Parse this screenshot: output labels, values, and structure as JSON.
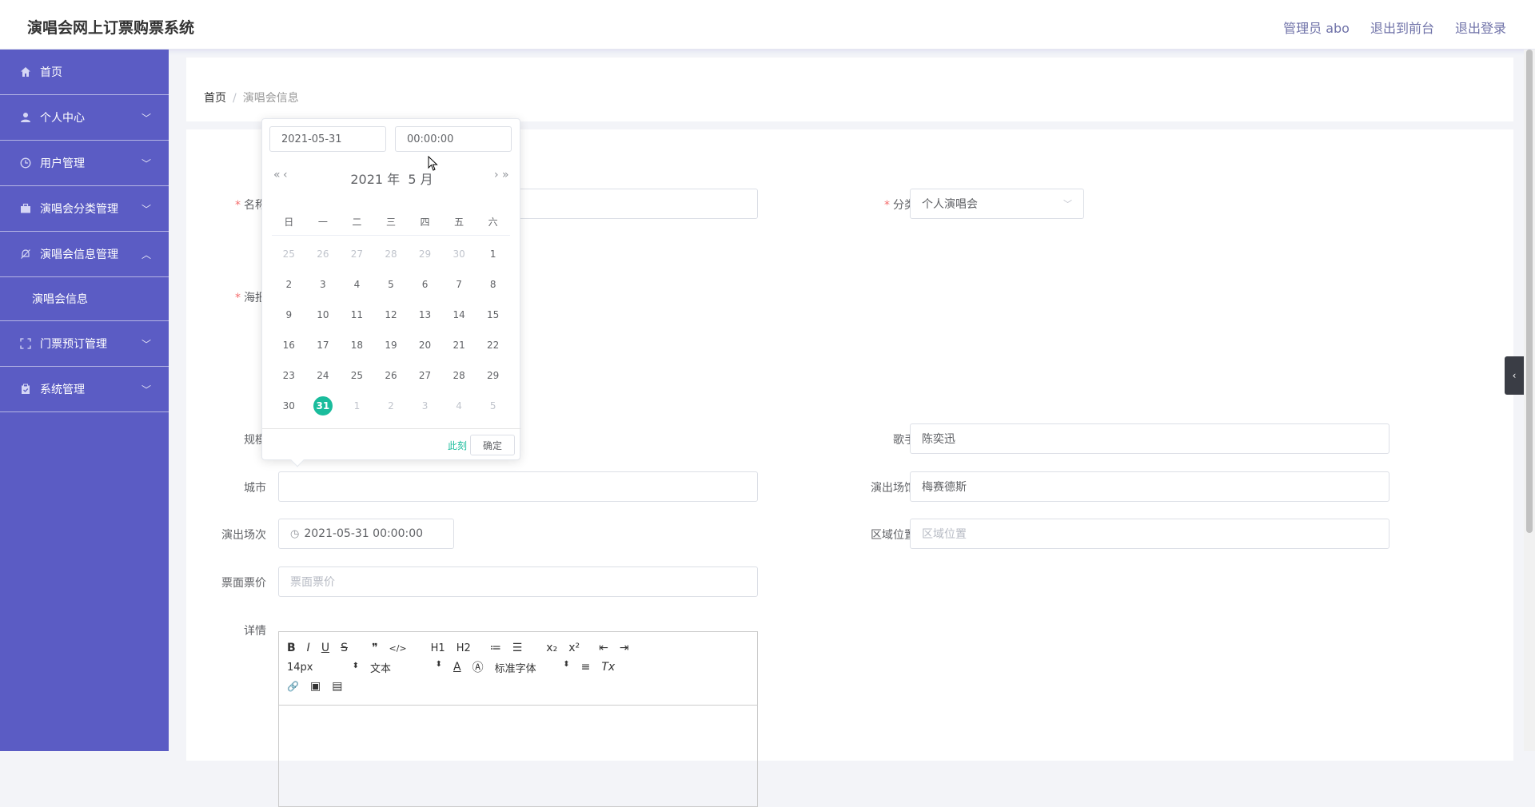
{
  "header": {
    "title": "演唱会网上订票购票系统",
    "links": [
      "管理员 abo",
      "退出到前台",
      "退出登录"
    ]
  },
  "sidebar": {
    "items": [
      {
        "label": "首页",
        "icon": "home-icon"
      },
      {
        "label": "个人中心",
        "icon": "user-icon"
      },
      {
        "label": "用户管理",
        "icon": "clock-icon"
      },
      {
        "label": "演唱会分类管理",
        "icon": "briefcase-icon"
      },
      {
        "label": "演唱会信息管理",
        "icon": "bell-off-icon"
      },
      {
        "label": "门票预订管理",
        "icon": "fullscreen-icon"
      },
      {
        "label": "系统管理",
        "icon": "clipboard-icon"
      }
    ],
    "submenu": "演唱会信息"
  },
  "breadcrumb": {
    "home": "首页",
    "current": "演唱会信息"
  },
  "form": {
    "name_label": "名称",
    "category_label": "分类",
    "category_value": "个人演唱会",
    "poster_label": "海报",
    "scale_label": "规模",
    "singer_label": "歌手",
    "singer_value": "陈奕迅",
    "city_label": "城市",
    "venue_label": "演出场馆",
    "venue_value": "梅赛德斯",
    "session_label": "演出场次",
    "session_value": "2021-05-31 00:00:00",
    "area_label": "区域位置",
    "area_placeholder": "区域位置",
    "price_label": "票面票价",
    "price_placeholder": "票面票价",
    "detail_label": "详情"
  },
  "editor": {
    "row1": [
      "B",
      "I",
      "U",
      "S",
      "❞",
      "</>",
      "H1",
      "H2",
      "≔",
      "☰",
      "x₂",
      "x²",
      "⇤",
      "⇥"
    ],
    "font_size": "14px",
    "block_type": "文本",
    "font_family": "标准字体",
    "row2_icons": [
      "A",
      "Ⓐ",
      "≡",
      "Tx"
    ],
    "row3": [
      "🔗",
      "▣",
      "▤"
    ]
  },
  "picker": {
    "date": "2021-05-31",
    "time": "00:00:00",
    "year": "2021 年",
    "month": "5 月",
    "weekdays": [
      "日",
      "一",
      "二",
      "三",
      "四",
      "五",
      "六"
    ],
    "weeks": [
      [
        "25",
        "26",
        "27",
        "28",
        "29",
        "30",
        "1"
      ],
      [
        "2",
        "3",
        "4",
        "5",
        "6",
        "7",
        "8"
      ],
      [
        "9",
        "10",
        "11",
        "12",
        "13",
        "14",
        "15"
      ],
      [
        "16",
        "17",
        "18",
        "19",
        "20",
        "21",
        "22"
      ],
      [
        "23",
        "24",
        "25",
        "26",
        "27",
        "28",
        "29"
      ],
      [
        "30",
        "31",
        "1",
        "2",
        "3",
        "4",
        "5"
      ]
    ],
    "now": "此刻",
    "confirm": "确定"
  }
}
